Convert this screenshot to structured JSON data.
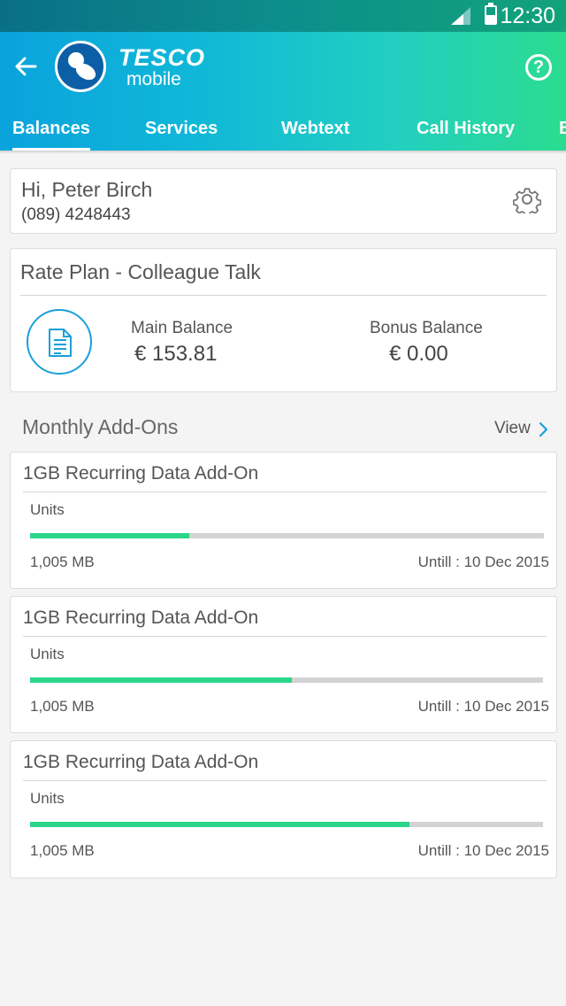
{
  "status_bar": {
    "time": "12:30"
  },
  "header": {
    "logo_line1": "TESCO",
    "logo_line2": "mobile",
    "help_glyph": "?",
    "tabs": [
      {
        "label": "Balances",
        "active": true
      },
      {
        "label": "Services"
      },
      {
        "label": "Webtext"
      },
      {
        "label": "Call History"
      },
      {
        "label": "B"
      }
    ]
  },
  "account": {
    "greeting": "Hi, Peter Birch",
    "phone": "(089) 4248443"
  },
  "rate_plan": {
    "title": "Rate Plan  - Colleague Talk",
    "main_balance_label": "Main Balance",
    "main_balance_value": "€  153.81",
    "bonus_balance_label": "Bonus Balance",
    "bonus_balance_value": "€  0.00"
  },
  "addons_section": {
    "title": "Monthly Add-Ons",
    "view_label": "View"
  },
  "addons": [
    {
      "title": "1GB Recurring Data Add-On",
      "units_label": "Units",
      "amount": "1,005 MB",
      "until": "Untill : 10 Dec 2015",
      "progress": 0.31
    },
    {
      "title": "1GB Recurring Data Add-On",
      "units_label": "Units",
      "amount": "1,005 MB",
      "until": "Untill : 10 Dec 2015",
      "progress": 0.51
    },
    {
      "title": "1GB Recurring Data Add-On",
      "units_label": "Units",
      "amount": "1,005 MB",
      "until": "Untill : 10 Dec 2015",
      "progress": 0.74
    }
  ],
  "colors": {
    "accent_blue": "#1aa0d9",
    "progress_green": "#2bd68a",
    "progress_track": "#d3d3d3"
  },
  "icons": [
    "back-arrow-icon",
    "help-icon",
    "gear-icon",
    "document-icon",
    "chevron-right-icon",
    "signal-icon",
    "battery-icon"
  ]
}
